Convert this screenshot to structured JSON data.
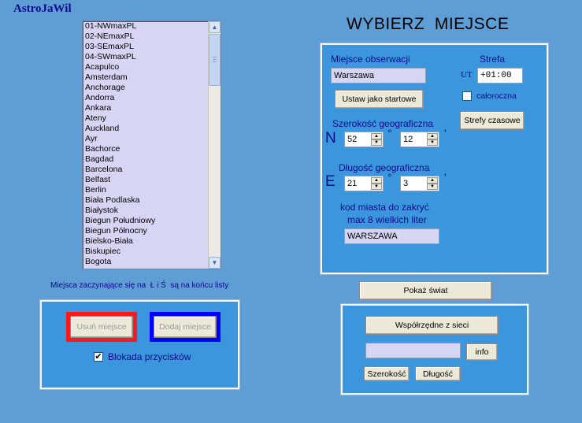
{
  "app": {
    "title": "AstroJaWil",
    "heading": "WYBIERZ  MIEJSCE"
  },
  "place_list": {
    "items": [
      "01-NWmaxPL",
      "02-NEmaxPL",
      "03-SEmaxPL",
      "04-SWmaxPL",
      "Acapulco",
      "Amsterdam",
      "Anchorage",
      "Andorra",
      "Ankara",
      "Ateny",
      "Auckland",
      "Ayr",
      "Bachorce",
      "Bagdad",
      "Barcelona",
      "Belfast",
      "Berlin",
      "Biała Podlaska",
      "Białystok",
      "Biegun Południowy",
      "Biegun Północny",
      "Bielsko-Biała",
      "Biskupiec",
      "Bogota"
    ]
  },
  "list_note": {
    "prefix": "Miejsca zaczynające się na",
    "letters": "Ł i Ś",
    "suffix": "są na końcu listy"
  },
  "left_panel": {
    "remove_label": "Usuń miejsce",
    "add_label": "Dodaj miejsce",
    "lock_checked": true,
    "lock_label": "Blokada przycisków"
  },
  "observation": {
    "place_label": "Miejsce obserwacji",
    "place_value": "Warszawa",
    "set_start_label": "Ustaw jako startowe",
    "zone_label": "Strefa",
    "ut_label": "UT",
    "zone_value": "+01:00",
    "yearround_checked": false,
    "yearround_label": "całoroczna",
    "zones_button": "Strefy czasowe",
    "lat_label": "Szerokość geograficzna",
    "lat_hemisphere": "N",
    "lat_deg": "52",
    "lat_min": "12",
    "lon_label": "Długość geograficzna",
    "lon_hemisphere": "E",
    "lon_deg": "21",
    "lon_min": "3",
    "deg_symbol": "°",
    "min_symbol": "'",
    "code_label_1": "kod miasta do zakryć",
    "code_label_2": "max 8 wielkich liter",
    "code_value": "WARSZAWA"
  },
  "show_world_label": "Pokaż świat",
  "net": {
    "coords_button": "Współrzędne z sieci",
    "query_value": "",
    "info_button": "info",
    "lat_button": "Szerokość",
    "lon_button": "Długość"
  }
}
